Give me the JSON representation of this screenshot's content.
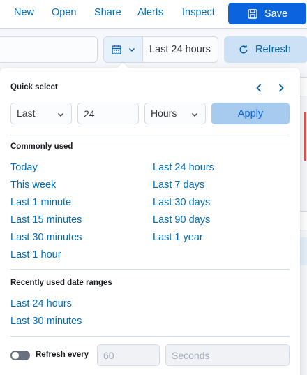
{
  "top_nav": {
    "items": [
      "New",
      "Open",
      "Share",
      "Alerts",
      "Inspect"
    ],
    "save_label": "Save"
  },
  "query_bar": {
    "time_range": "Last 24 hours",
    "refresh_label": "Refresh"
  },
  "quick_select": {
    "heading": "Quick select",
    "direction": "Last",
    "value": "24",
    "unit": "Hours",
    "apply_label": "Apply"
  },
  "commonly_used": {
    "heading": "Commonly used",
    "left": [
      "Today",
      "This week",
      "Last 1 minute",
      "Last 15 minutes",
      "Last 30 minutes",
      "Last 1 hour"
    ],
    "right": [
      "Last 24 hours",
      "Last 7 days",
      "Last 30 days",
      "Last 90 days",
      "Last 1 year"
    ]
  },
  "recently_used": {
    "heading": "Recently used date ranges",
    "items": [
      "Last 24 hours",
      "Last 30 minutes"
    ]
  },
  "refresh_every": {
    "label": "Refresh every",
    "enabled": false,
    "interval_placeholder": "60",
    "unit_placeholder": "Seconds"
  },
  "colors": {
    "accent": "#0b64dd",
    "link": "#006bb8",
    "apply_bg": "#a6cbef",
    "refresh_bg": "#cce1f5"
  }
}
